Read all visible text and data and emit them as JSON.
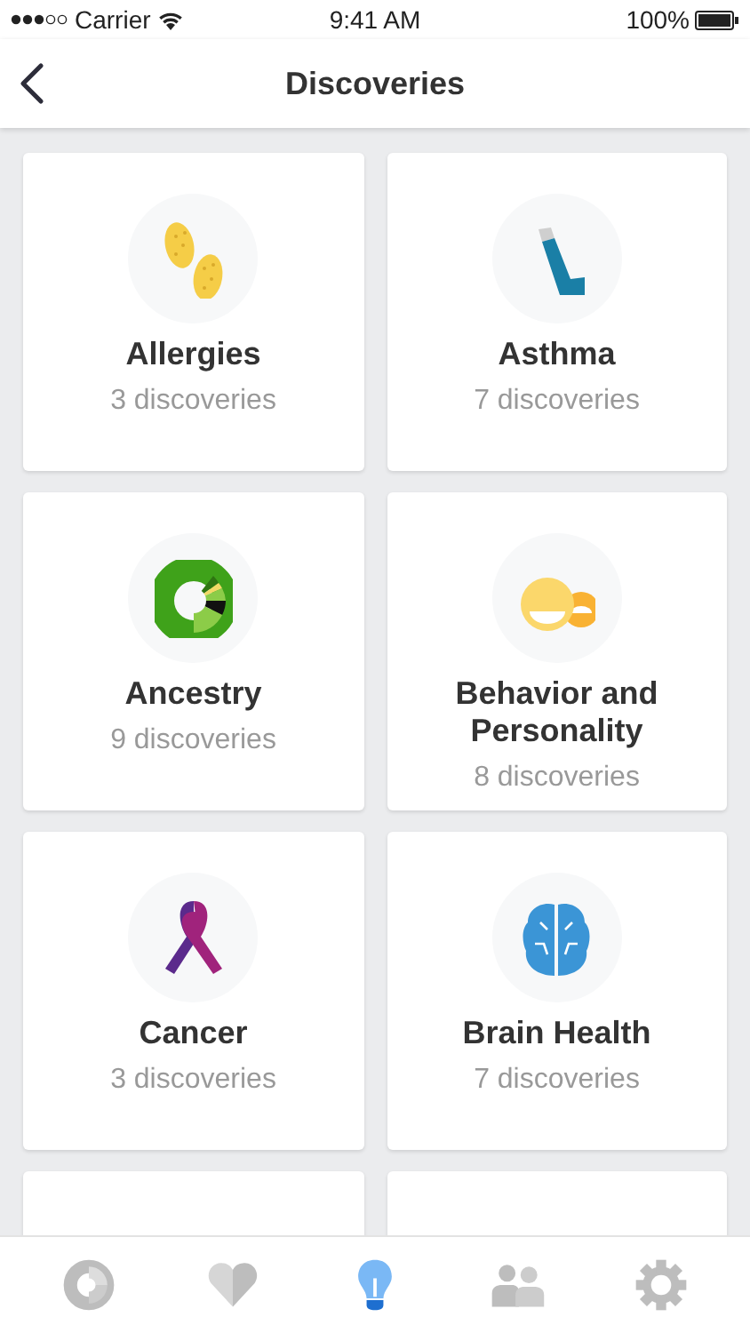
{
  "status_bar": {
    "carrier": "Carrier",
    "time": "9:41 AM",
    "battery": "100%"
  },
  "nav": {
    "title": "Discoveries"
  },
  "cards": [
    {
      "kind": "pollen",
      "title": "Allergies",
      "subtitle": "3 discoveries"
    },
    {
      "kind": "inhaler",
      "title": "Asthma",
      "subtitle": "7 discoveries"
    },
    {
      "kind": "donut",
      "title": "Ancestry",
      "subtitle": "9 discoveries"
    },
    {
      "kind": "faces",
      "title": "Behavior and Personality",
      "subtitle": "8 discoveries"
    },
    {
      "kind": "ribbon",
      "title": "Cancer",
      "subtitle": "3 discoveries"
    },
    {
      "kind": "brain",
      "title": "Brain Health",
      "subtitle": "7 discoveries"
    },
    {
      "kind": "blank"
    },
    {
      "kind": "blank"
    }
  ],
  "tabs": [
    {
      "kind": "report",
      "selected": false
    },
    {
      "kind": "health",
      "selected": false
    },
    {
      "kind": "discoveries",
      "selected": true
    },
    {
      "kind": "family",
      "selected": false
    },
    {
      "kind": "settings",
      "selected": false
    }
  ]
}
